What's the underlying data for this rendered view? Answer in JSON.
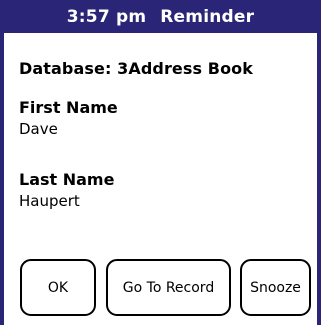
{
  "titlebar": {
    "time": "3:57 pm",
    "title": "Reminder"
  },
  "database_line": "Database:  3Address Book",
  "fields": {
    "first_name": {
      "label": "First Name",
      "value": "Dave"
    },
    "last_name": {
      "label": "Last Name",
      "value": "Haupert"
    }
  },
  "buttons": {
    "ok": "OK",
    "go_to_record": "Go To Record",
    "snooze": "Snooze"
  },
  "colors": {
    "titlebar_bg": "#2b2577",
    "titlebar_fg": "#ffffff",
    "background": "#ffffff",
    "text": "#000000"
  }
}
